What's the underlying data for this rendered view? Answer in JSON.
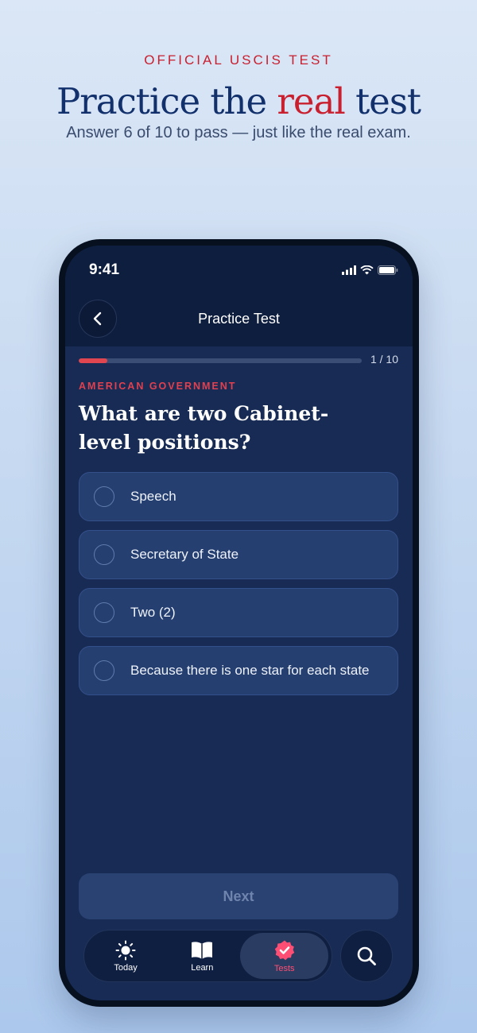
{
  "promo": {
    "eyebrow": "OFFICIAL USCIS TEST",
    "headline_pre": "Practice the ",
    "headline_accent": "real",
    "headline_post": " test",
    "subhead": "Answer 6 of 10 to pass — just like the real exam."
  },
  "status_bar": {
    "time": "9:41"
  },
  "nav": {
    "title": "Practice Test",
    "back_icon": "chevron-left-icon"
  },
  "progress": {
    "text": "1 / 10",
    "fraction": 0.1
  },
  "question": {
    "category": "AMERICAN GOVERNMENT",
    "text": "What are two Cabinet-level positions?"
  },
  "options": [
    {
      "label": "Speech"
    },
    {
      "label": "Secretary of State"
    },
    {
      "label": "Two (2)"
    },
    {
      "label": "Because there is one star for each state"
    }
  ],
  "next_button": {
    "label": "Next"
  },
  "tabbar": {
    "tabs": [
      {
        "label": "Today",
        "icon": "sun-icon"
      },
      {
        "label": "Learn",
        "icon": "book-icon"
      },
      {
        "label": "Tests",
        "icon": "badge-check-icon",
        "active": true
      }
    ],
    "search_icon": "search-icon"
  },
  "colors": {
    "accent_red": "#c8202f",
    "navy": "#12306b",
    "screen_bg": "#172b54",
    "active_tab": "#ff4e74"
  }
}
